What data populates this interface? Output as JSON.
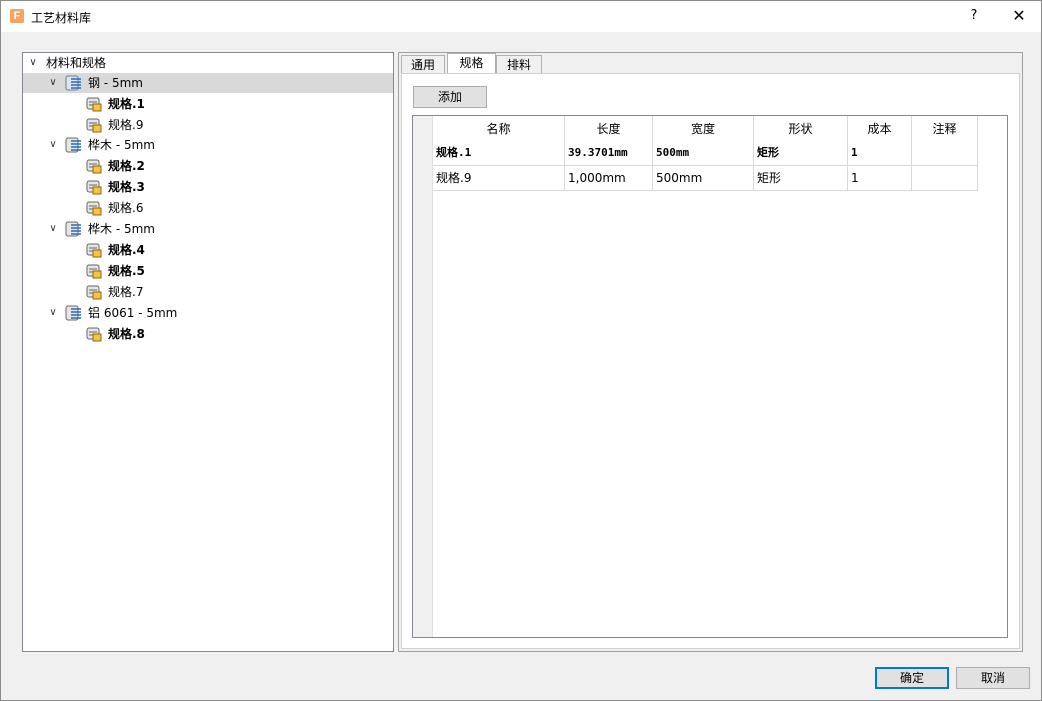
{
  "window": {
    "title": "工艺材料库",
    "help": "?",
    "close": "✕"
  },
  "tree": {
    "root": "材料和规格",
    "materials": [
      {
        "label": "钢 - 5mm",
        "specs": [
          {
            "label": "规格.1",
            "bold": true
          },
          {
            "label": "规格.9",
            "bold": false
          }
        ]
      },
      {
        "label": "桦木 - 5mm",
        "specs": [
          {
            "label": "规格.2",
            "bold": true
          },
          {
            "label": "规格.3",
            "bold": true
          },
          {
            "label": "规格.6",
            "bold": false
          }
        ]
      },
      {
        "label": "桦木 - 5mm",
        "specs": [
          {
            "label": "规格.4",
            "bold": true
          },
          {
            "label": "规格.5",
            "bold": true
          },
          {
            "label": "规格.7",
            "bold": false
          }
        ]
      },
      {
        "label": "铝 6061 - 5mm",
        "specs": [
          {
            "label": "规格.8",
            "bold": true
          }
        ]
      }
    ]
  },
  "tabs": [
    "通用",
    "规格",
    "排料"
  ],
  "active_tab": "规格",
  "add_button": "添加",
  "table": {
    "headers": [
      "名称",
      "长度",
      "宽度",
      "形状",
      "成本",
      "注释"
    ],
    "rows": [
      {
        "bold": true,
        "cells": [
          "规格.1",
          "39.3701mm",
          "500mm",
          "矩形",
          "1",
          ""
        ]
      },
      {
        "bold": false,
        "cells": [
          "规格.9",
          "1,000mm",
          "500mm",
          "矩形",
          "1",
          ""
        ]
      }
    ]
  },
  "buttons": {
    "ok": "确定",
    "cancel": "取消"
  },
  "colors": {
    "selection": "#d9d9d9",
    "default_button_border": "#0078d7",
    "app_icon": "#f4a460"
  }
}
